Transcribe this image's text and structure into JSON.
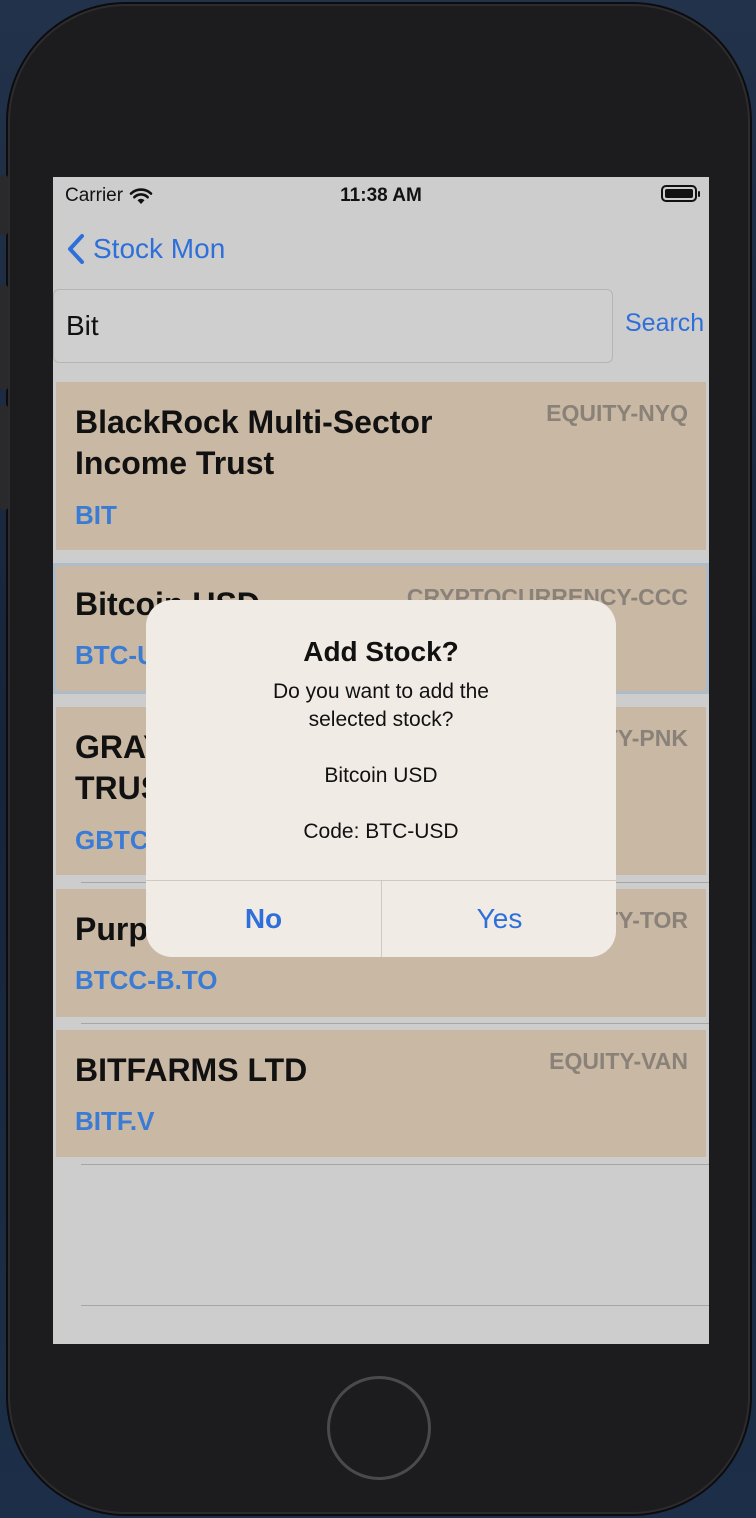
{
  "status_bar": {
    "carrier": "Carrier",
    "time": "11:38 AM"
  },
  "nav": {
    "back_label": "Stock Mon"
  },
  "search": {
    "value": "Bit",
    "button_label": "Search"
  },
  "results": [
    {
      "name_line1": "BlackRock Multi-Sector",
      "name_line2": "Income Trust",
      "code": "BIT",
      "type": "EQUITY-NYQ"
    },
    {
      "name_line1": "Bitcoin USD",
      "name_line2": "",
      "code": "BTC-USD",
      "type": "CRYPTOCURRENCY-CCC"
    },
    {
      "name_line1": "GRAYSCALE BITCOIN",
      "name_line2": "TRUST",
      "code": "GBTC",
      "type": "EQUITY-PNK"
    },
    {
      "name_line1": "Purpose Bitcoin ETF",
      "name_line2": "",
      "code": "BTCC-B.TO",
      "type": "EQUITY-TOR"
    },
    {
      "name_line1": "BITFARMS LTD",
      "name_line2": "",
      "code": "BITF.V",
      "type": "EQUITY-VAN"
    }
  ],
  "alert": {
    "title": "Add Stock?",
    "message_line1": "Do you want to add the",
    "message_line2": "selected stock?",
    "stock_name": "Bitcoin USD",
    "stock_code": "Code:  BTC-USD",
    "no_label": "No",
    "yes_label": "Yes"
  },
  "colors": {
    "accent": "#2f6fd9",
    "row_background": "#c8b8a4",
    "code_blue": "#3a7bd5"
  }
}
